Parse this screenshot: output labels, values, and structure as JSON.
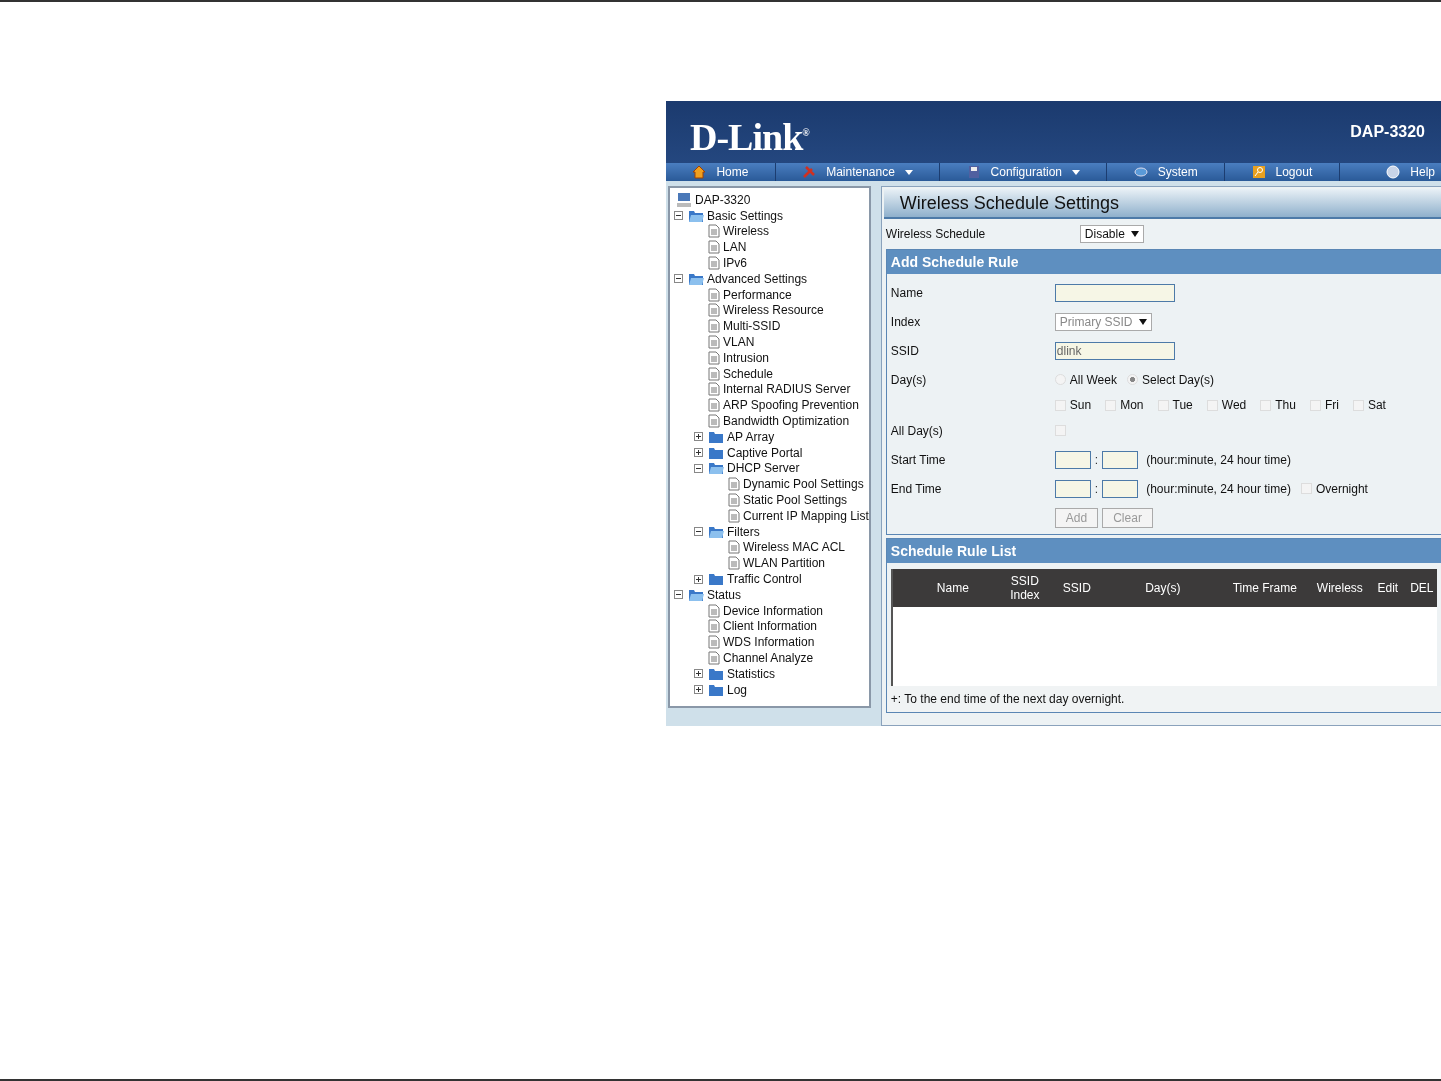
{
  "header": {
    "logo": "D-Link$^{®}$",
    "model": "DAP-3320"
  },
  "nav": [
    {
      "label": "Home",
      "dropdown": false
    },
    {
      "label": "Maintenance",
      "dropdown": true
    },
    {
      "label": "Configuration",
      "dropdown": true
    },
    {
      "label": "System",
      "dropdown": false
    },
    {
      "label": "Logout",
      "dropdown": false
    },
    {
      "label": "Help",
      "dropdown": false
    }
  ],
  "tree": [
    {
      "kind": "device",
      "label": "DAP-3320",
      "children": [
        {
          "kind": "folder",
          "label": "Basic Settings",
          "expanded": true,
          "children": [
            {
              "kind": "page",
              "label": "Wireless"
            },
            {
              "kind": "page",
              "label": "LAN"
            },
            {
              "kind": "page",
              "label": "IPv6"
            }
          ]
        },
        {
          "kind": "folder",
          "label": "Advanced Settings",
          "expanded": true,
          "children": [
            {
              "kind": "page",
              "label": "Performance"
            },
            {
              "kind": "page",
              "label": "Wireless Resource"
            },
            {
              "kind": "page",
              "label": "Multi-SSID"
            },
            {
              "kind": "page",
              "label": "VLAN"
            },
            {
              "kind": "page",
              "label": "Intrusion"
            },
            {
              "kind": "page",
              "label": "Schedule"
            },
            {
              "kind": "page",
              "label": "Internal RADIUS Server"
            },
            {
              "kind": "page",
              "label": "ARP Spoofing Prevention"
            },
            {
              "kind": "page",
              "label": "Bandwidth Optimization"
            },
            {
              "kind": "folder",
              "label": "AP Array",
              "expanded": false
            },
            {
              "kind": "folder",
              "label": "Captive Portal",
              "expanded": false
            },
            {
              "kind": "folder",
              "label": "DHCP Server",
              "expanded": true,
              "children": [
                {
                  "kind": "page",
                  "label": "Dynamic Pool Settings"
                },
                {
                  "kind": "page",
                  "label": "Static Pool Settings"
                },
                {
                  "kind": "page",
                  "label": "Current IP Mapping List"
                }
              ]
            },
            {
              "kind": "folder",
              "label": "Filters",
              "expanded": true,
              "children": [
                {
                  "kind": "page",
                  "label": "Wireless MAC ACL"
                },
                {
                  "kind": "page",
                  "label": "WLAN Partition"
                }
              ]
            },
            {
              "kind": "folder",
              "label": "Traffic Control",
              "expanded": false
            }
          ]
        },
        {
          "kind": "folder",
          "label": "Status",
          "expanded": true,
          "children": [
            {
              "kind": "page",
              "label": "Device Information"
            },
            {
              "kind": "page",
              "label": "Client Information"
            },
            {
              "kind": "page",
              "label": "WDS Information"
            },
            {
              "kind": "page",
              "label": "Channel Analyze"
            },
            {
              "kind": "folder",
              "label": "Statistics",
              "expanded": false
            },
            {
              "kind": "folder",
              "label": "Log",
              "expanded": false
            }
          ]
        }
      ]
    }
  ],
  "main": {
    "title": "Wireless Schedule Settings",
    "wireless_schedule": {
      "label": "Wireless Schedule",
      "value": "Disable"
    },
    "add_rule": {
      "title": "Add Schedule Rule",
      "name": {
        "label": "Name"
      },
      "index": {
        "label": "Index",
        "value": "Primary SSID",
        "disabled": true
      },
      "ssid": {
        "label": "SSID",
        "value": "dlink"
      },
      "days": {
        "label": "Day(s)",
        "modes": [
          {
            "label": "All Week",
            "selected": false
          },
          {
            "label": "Select Day(s)",
            "selected": true
          }
        ],
        "weekdays": [
          {
            "label": "Sun",
            "checked": false
          },
          {
            "label": "Mon",
            "checked": false
          },
          {
            "label": "Tue",
            "checked": false
          },
          {
            "label": "Wed",
            "checked": false
          },
          {
            "label": "Thu",
            "checked": false
          },
          {
            "label": "Fri",
            "checked": false
          },
          {
            "label": "Sat",
            "checked": false
          }
        ]
      },
      "all_days": {
        "label": "All Day(s)",
        "checked": false
      },
      "start_time": {
        "label": "Start Time",
        "separator": ":",
        "hint": "(hour:minute, 24 hour time)"
      },
      "end_time": {
        "label": "End Time",
        "separator": ":",
        "hint": "(hour:minute, 24 hour time)",
        "overnight": {
          "label": "Overnight",
          "checked": false
        }
      },
      "buttons": [
        {
          "label": "Add",
          "disabled": true
        },
        {
          "label": "Clear",
          "disabled": true
        }
      ]
    },
    "rule_list": {
      "title": "Schedule Rule List",
      "columns": [
        "Name",
        "SSID Index",
        "SSID",
        "Day(s)",
        "Time Frame",
        "Wireless",
        "Edit",
        "DEL"
      ],
      "footnote": "+: To the end time of the next day overnight."
    }
  }
}
